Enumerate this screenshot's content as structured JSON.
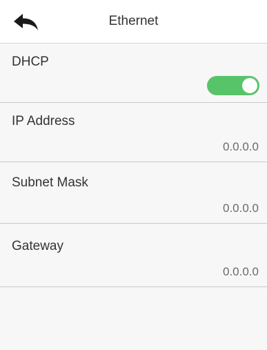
{
  "header": {
    "title": "Ethernet",
    "back_icon": "back-arrow-icon"
  },
  "settings": {
    "dhcp": {
      "label": "DHCP",
      "enabled": true,
      "toggle_color": "#58c46a"
    },
    "ip_address": {
      "label": "IP Address",
      "value": "0.0.0.0"
    },
    "subnet_mask": {
      "label": "Subnet Mask",
      "value": "0.0.0.0"
    },
    "gateway": {
      "label": "Gateway",
      "value": "0.0.0.0"
    }
  }
}
